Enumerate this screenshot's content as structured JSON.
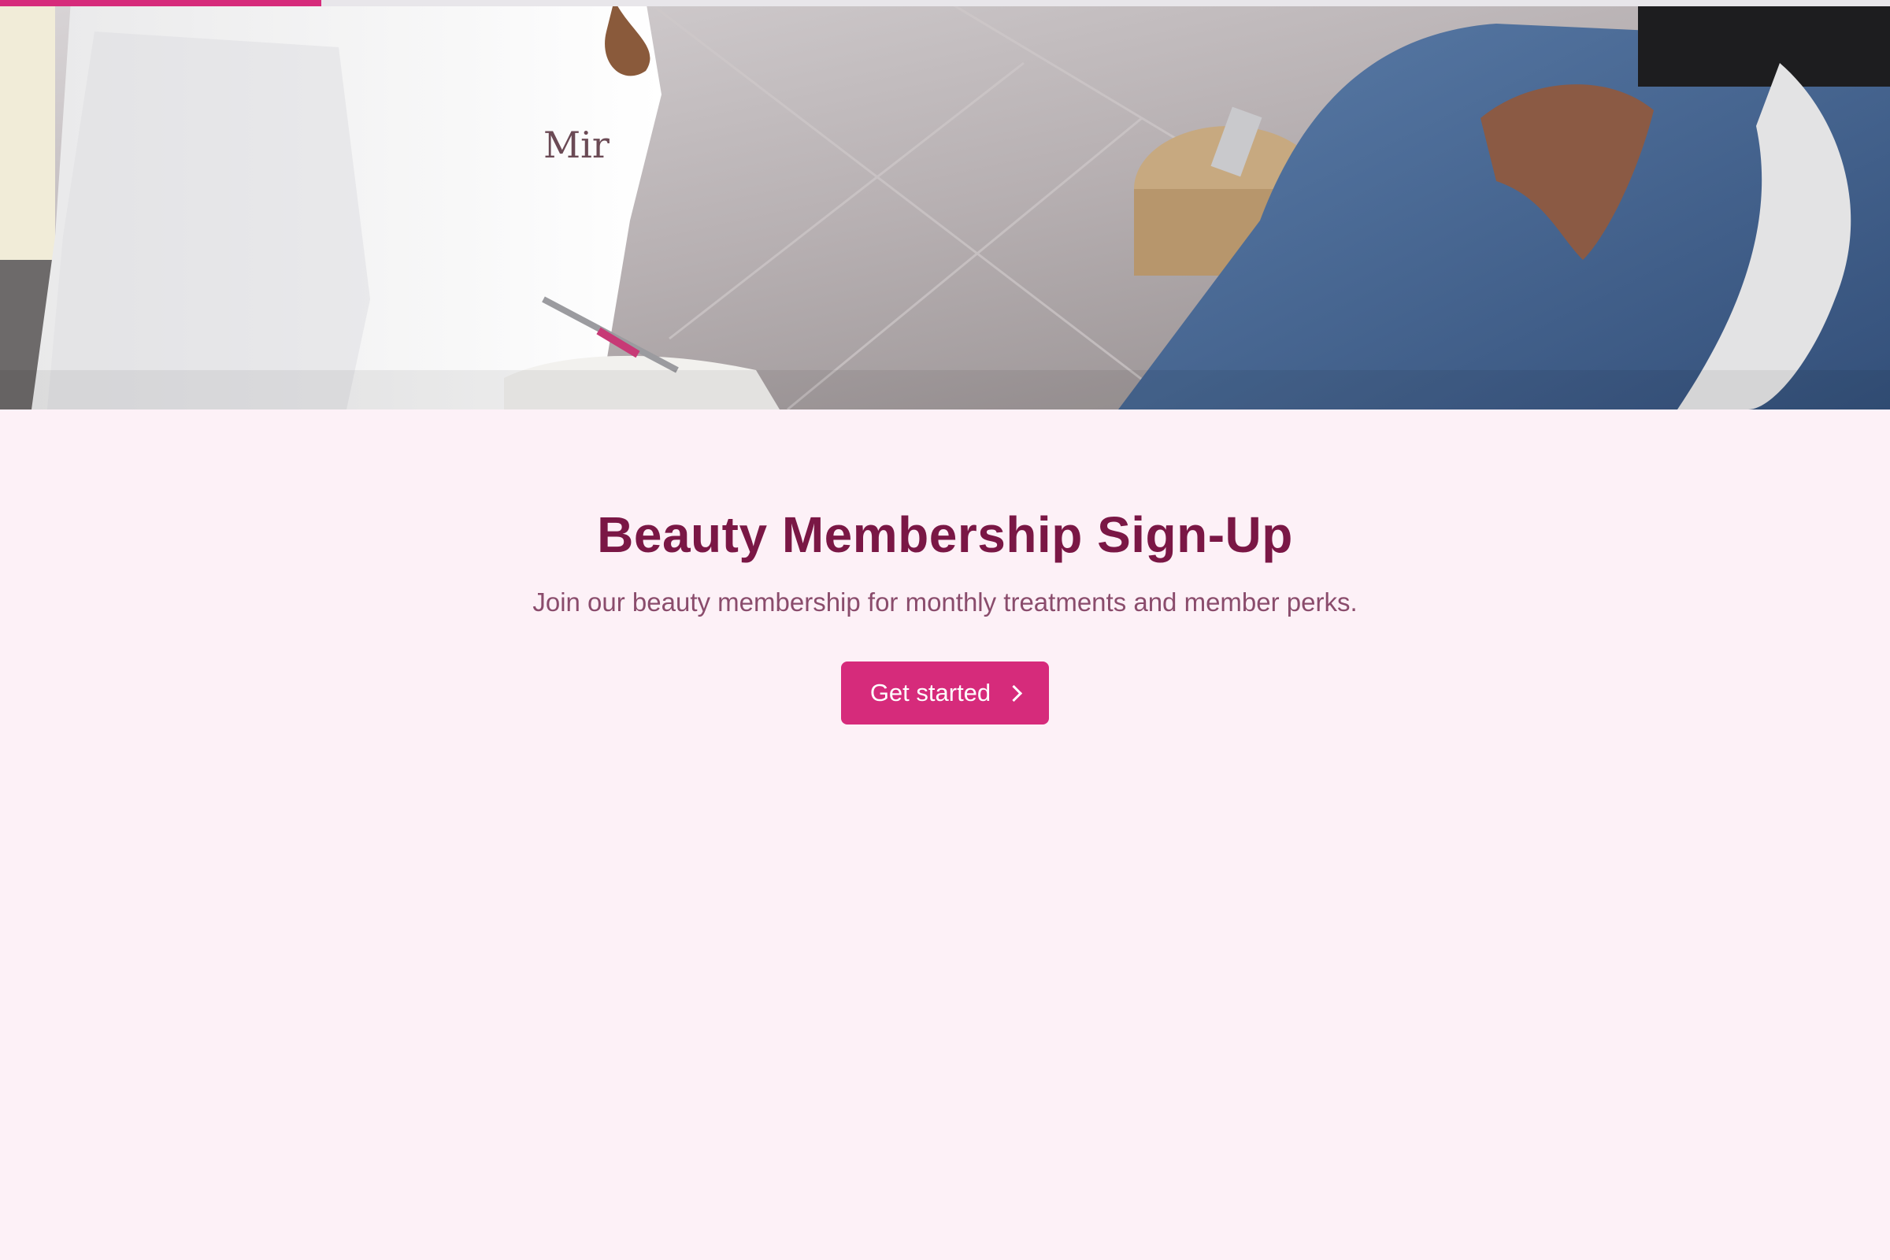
{
  "progress": {
    "value_fraction": 0.17,
    "color": "#d62b7b",
    "track_color": "#e8e6ea"
  },
  "hero": {
    "image_description_icon": "photo-manicure-pedicure",
    "shirt_logo_text": "Mir"
  },
  "page": {
    "title": "Beauty Membership Sign-Up",
    "subtitle": "Join our beauty membership for monthly treatments and member perks.",
    "cta_label": "Get started",
    "cta_icon": "chevron-right-icon"
  },
  "colors": {
    "background": "#fdf1f7",
    "title": "#7a1745",
    "subtitle": "#8a4c6c",
    "accent": "#d62b7b"
  }
}
